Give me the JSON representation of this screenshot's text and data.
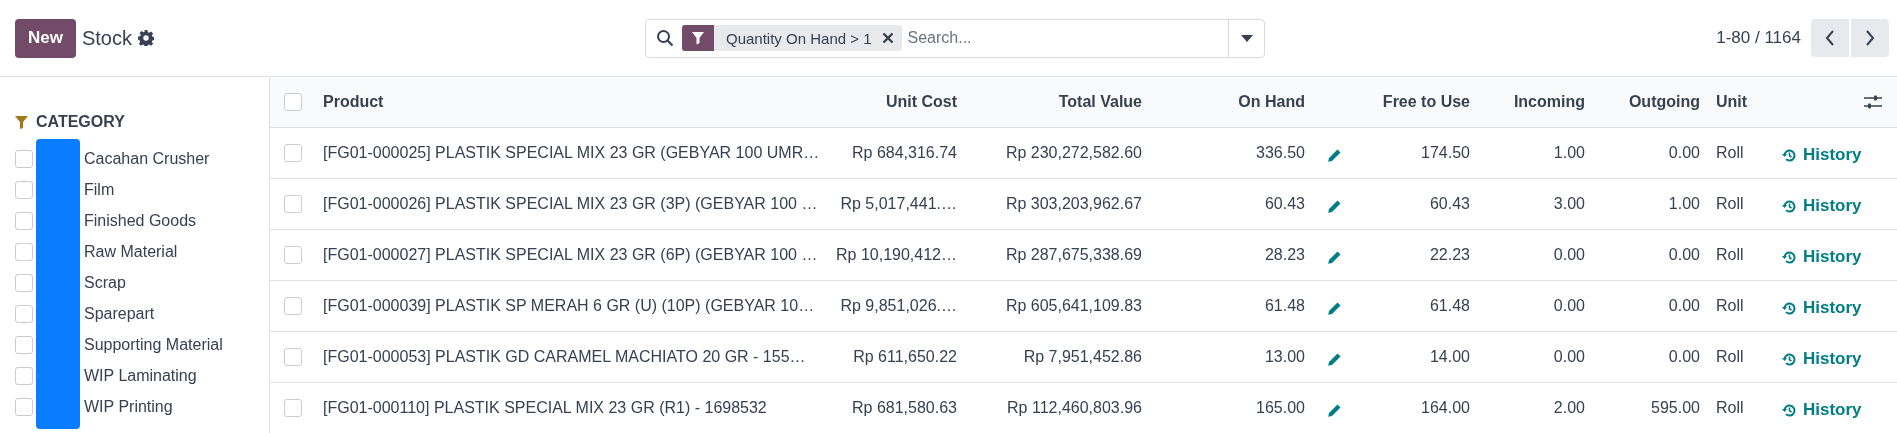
{
  "control_panel": {
    "new_button": "New",
    "title": "Stock",
    "search": {
      "facets": [
        {
          "label": "Quantity On Hand > 1"
        }
      ],
      "placeholder": "Search..."
    },
    "pager": "1-80 / 1164"
  },
  "sidebar": {
    "heading": "CATEGORY",
    "items": [
      {
        "label": "Cacahan Crusher",
        "checked": false
      },
      {
        "label": "Film",
        "checked": false
      },
      {
        "label": "Finished Goods",
        "checked": false
      },
      {
        "label": "Raw Material",
        "checked": false
      },
      {
        "label": "Scrap",
        "checked": false
      },
      {
        "label": "Sparepart",
        "checked": false
      },
      {
        "label": "Supporting Material",
        "checked": false
      },
      {
        "label": "WIP Laminating",
        "checked": false
      },
      {
        "label": "WIP Printing",
        "checked": false
      }
    ]
  },
  "table": {
    "all_selected": false,
    "columns": [
      "Product",
      "Unit Cost",
      "Total Value",
      "On Hand",
      "Free to Use",
      "Incoming",
      "Outgoing",
      "Unit"
    ],
    "rows": [
      {
        "selected": false,
        "product": "[FG01-000025] PLASTIK SPECIAL MIX 23 GR (GEBYAR 100 UMR…",
        "unit_cost": "Rp 684,316.74",
        "total_value": "Rp 230,272,582.60",
        "on_hand": "336.50",
        "free_to_use": "174.50",
        "incoming": "1.00",
        "outgoing": "0.00",
        "unit": "Roll",
        "action": "History"
      },
      {
        "selected": false,
        "product": "[FG01-000026] PLASTIK SPECIAL MIX 23 GR (3P) (GEBYAR 100 …",
        "unit_cost": "Rp 5,017,441.…",
        "total_value": "Rp 303,203,962.67",
        "on_hand": "60.43",
        "free_to_use": "60.43",
        "incoming": "3.00",
        "outgoing": "1.00",
        "unit": "Roll",
        "action": "History"
      },
      {
        "selected": false,
        "product": "[FG01-000027] PLASTIK SPECIAL MIX 23 GR (6P) (GEBYAR 100 …",
        "unit_cost": "Rp 10,190,412…",
        "total_value": "Rp 287,675,338.69",
        "on_hand": "28.23",
        "free_to_use": "22.23",
        "incoming": "0.00",
        "outgoing": "0.00",
        "unit": "Roll",
        "action": "History"
      },
      {
        "selected": false,
        "product": "[FG01-000039] PLASTIK SP MERAH 6 GR (U) (10P) (GEBYAR 10…",
        "unit_cost": "Rp 9,851,026.…",
        "total_value": "Rp 605,641,109.83",
        "on_hand": "61.48",
        "free_to_use": "61.48",
        "incoming": "0.00",
        "outgoing": "0.00",
        "unit": "Roll",
        "action": "History"
      },
      {
        "selected": false,
        "product": "[FG01-000053] PLASTIK GD CARAMEL MACHIATO 20 GR - 155…",
        "unit_cost": "Rp 611,650.22",
        "total_value": "Rp 7,951,452.86",
        "on_hand": "13.00",
        "free_to_use": "14.00",
        "incoming": "0.00",
        "outgoing": "0.00",
        "unit": "Roll",
        "action": "History"
      },
      {
        "selected": false,
        "product": "[FG01-000110] PLASTIK SPECIAL MIX 23 GR (R1) - 1698532",
        "unit_cost": "Rp 681,580.63",
        "total_value": "Rp 112,460,803.96",
        "on_hand": "165.00",
        "free_to_use": "164.00",
        "incoming": "2.00",
        "outgoing": "595.00",
        "unit": "Roll",
        "action": "History"
      }
    ]
  }
}
